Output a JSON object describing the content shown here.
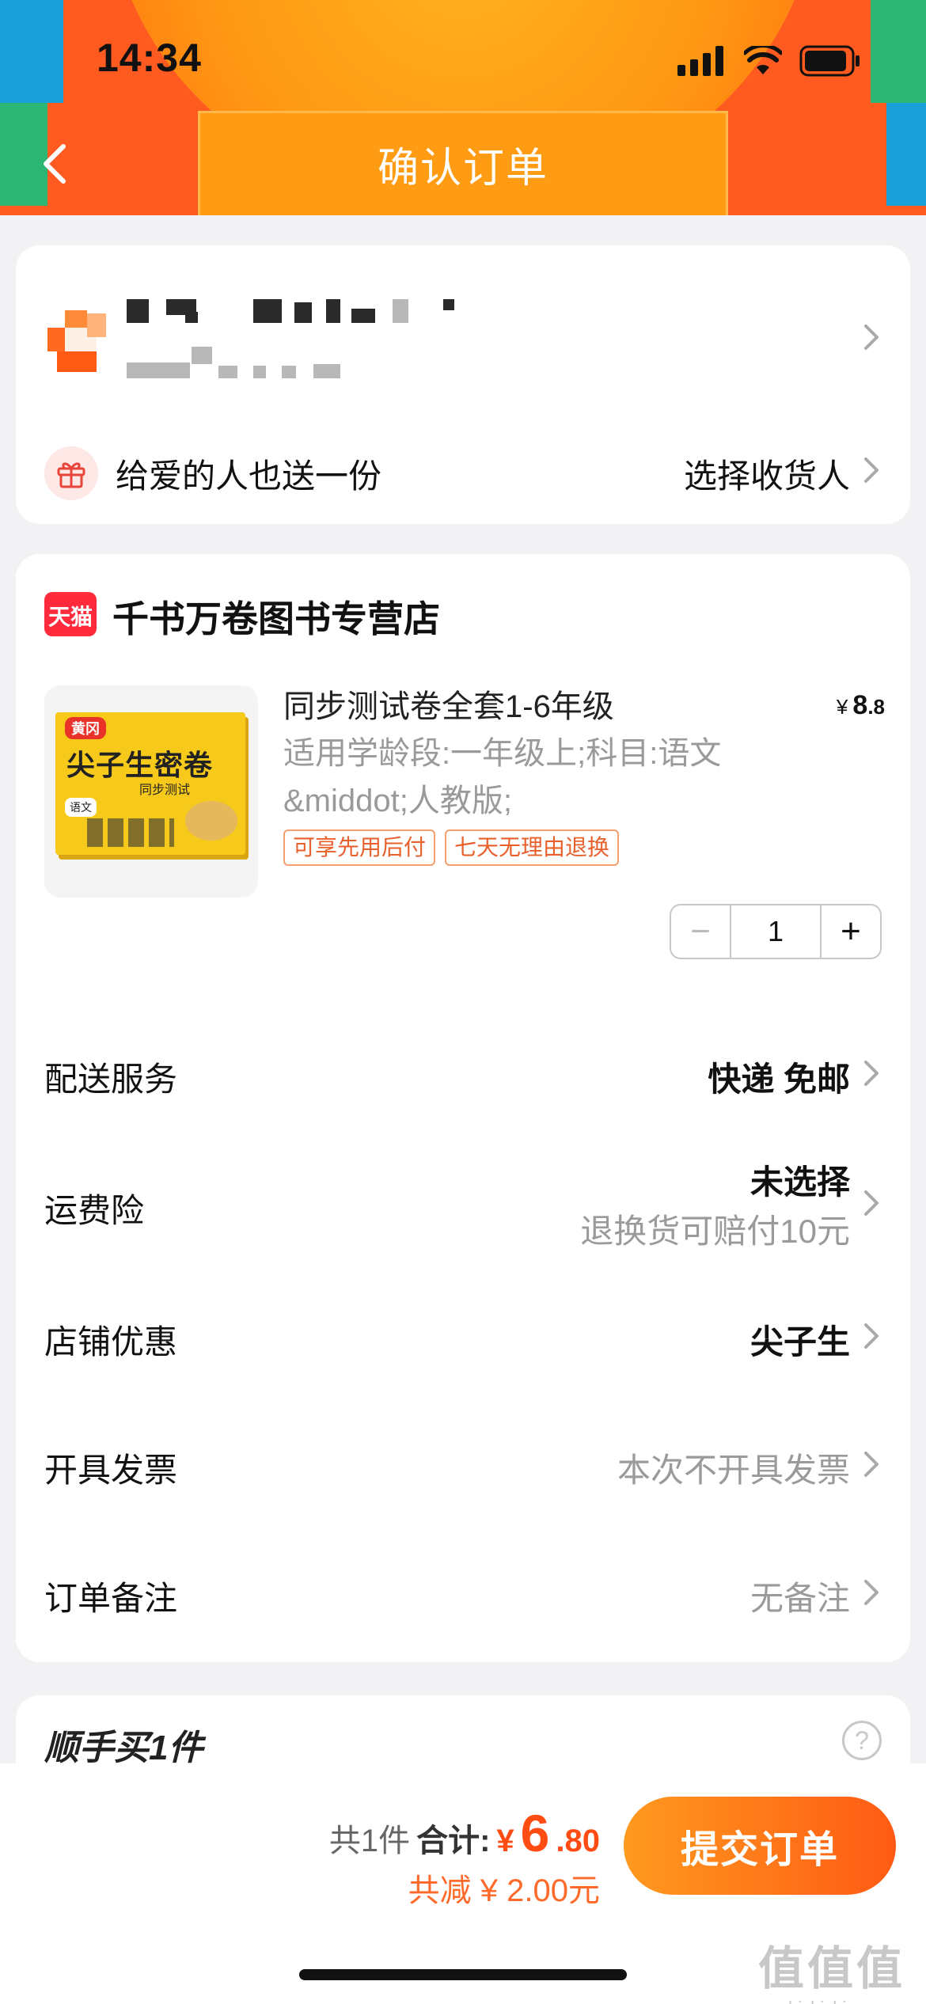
{
  "status_bar": {
    "time": "14:34"
  },
  "nav": {
    "title": "确认订单"
  },
  "address": {
    "gift_text": "给爱的人也送一份",
    "select_receiver": "选择收货人"
  },
  "shop": {
    "badge": "天猫",
    "name": "千书万卷图书专营店"
  },
  "product": {
    "title": "同步测试卷全套1-6年级",
    "price_currency": "¥",
    "price_int": "8",
    "price_dec": ".8",
    "spec": "适用学龄段:一年级上;科目:语文&middot;人教版;",
    "tags": [
      "可享先用后付",
      "七天无理由退换"
    ],
    "cover": {
      "brand": "黄冈",
      "title": "尖子生密卷",
      "subtitle": "同步测试",
      "subject": "语文"
    },
    "quantity": "1",
    "minus": "−",
    "plus": "+"
  },
  "rows": {
    "delivery": {
      "label": "配送服务",
      "value": "快递 免邮"
    },
    "insurance": {
      "label": "运费险",
      "value": "未选择",
      "sub": "退换货可赔付10元"
    },
    "coupon": {
      "label": "店铺优惠",
      "value": "尖子生"
    },
    "invoice": {
      "label": "开具发票",
      "value": "本次不开具发票"
    },
    "remark": {
      "label": "订单备注",
      "value": "无备注"
    }
  },
  "extra": {
    "title": "顺手买1件",
    "help": "?"
  },
  "bottom": {
    "count": "共1件",
    "total_label": "合计:",
    "currency": "¥",
    "total_int": "6",
    "total_dec": ".80",
    "discount": "共减 ¥ 2.00元",
    "submit": "提交订单"
  },
  "watermark": {
    "logo": "值值值",
    "url": "zhizhizhi.com"
  },
  "colors": {
    "accent": "#ff5a1f",
    "price": "#ff4c12",
    "tag": "#e8612c"
  }
}
